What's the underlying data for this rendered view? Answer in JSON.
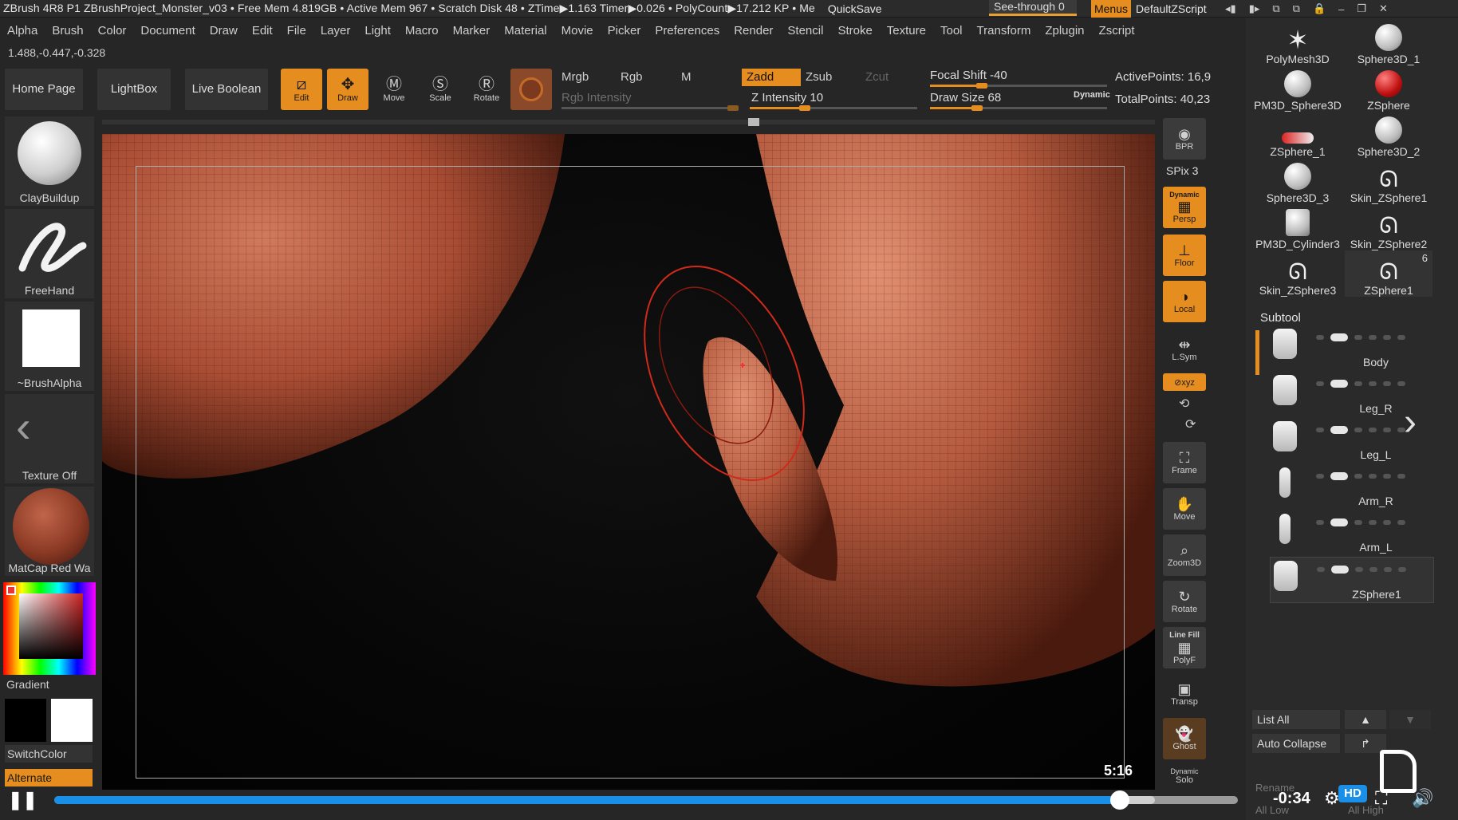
{
  "titlebar": {
    "title": "ZBrush 4R8 P1   ZBrushProject_Monster_v03   • Free Mem 4.819GB • Active Mem 967 • Scratch Disk 48 • ZTime▶1.163 Timer▶0.026 • PolyCount▶17.212 KP • Me",
    "quicksave": "QuickSave",
    "seethrough": "See-through  0",
    "menus": "Menus",
    "default_zscript": "DefaultZScript",
    "icons": [
      "◂▮",
      "▮▸",
      "⧉",
      "⧉",
      "🔒",
      "–",
      "❐",
      "✕"
    ]
  },
  "menubar": [
    "Alpha",
    "Brush",
    "Color",
    "Document",
    "Draw",
    "Edit",
    "File",
    "Layer",
    "Light",
    "Macro",
    "Marker",
    "Material",
    "Movie",
    "Picker",
    "Preferences",
    "Render",
    "Stencil",
    "Stroke",
    "Texture",
    "Tool",
    "Transform",
    "Zplugin",
    "Zscript"
  ],
  "coords": "1.488,-0.447,-0.328",
  "nav": {
    "home": "Home Page",
    "lightbox": "LightBox",
    "live_boolean": "Live Boolean"
  },
  "toolbar": {
    "edit": "Edit",
    "draw": "Draw",
    "move": "Move",
    "scale": "Scale",
    "rotate": "Rotate",
    "mrgb": "Mrgb",
    "rgb": "Rgb",
    "m": "M",
    "zadd": "Zadd",
    "zsub": "Zsub",
    "zcut": "Zcut",
    "rgb_intensity": "Rgb Intensity",
    "z_intensity": "Z Intensity 10",
    "focal_shift": "Focal Shift -40",
    "draw_size": "Draw Size 68",
    "dynamic": "Dynamic",
    "active_points": "ActivePoints: 16,9",
    "total_points": "TotalPoints: 40,23"
  },
  "shelf": {
    "brush": "ClayBuildup",
    "stroke": "FreeHand",
    "alpha": "~BrushAlpha",
    "texture": "Texture Off",
    "material": "MatCap Red Wa",
    "gradient": "Gradient",
    "switch_color": "SwitchColor",
    "alternate": "Alternate"
  },
  "right_toolbar": {
    "bpr": "BPR",
    "spix": "SPix 3",
    "persp": "Persp",
    "persp_tag": "Dynamic",
    "floor": "Floor",
    "local": "Local",
    "lsym": "L.Sym",
    "xyz": "⊘xyz",
    "frame": "Frame",
    "move": "Move",
    "zoom3d": "Zoom3D",
    "rotate": "Rotate",
    "linefill": "Line Fill",
    "polyf": "PolyF",
    "transp": "Transp",
    "ghost": "Ghost",
    "solo_tag": "Dynamic",
    "solo": "Solo"
  },
  "tools": [
    {
      "name": "PolyMesh3D",
      "icon": "star-icon"
    },
    {
      "name": "Sphere3D_1",
      "icon": "sphere-icon"
    },
    {
      "name": "PM3D_Sphere3D",
      "icon": "sphere-icon"
    },
    {
      "name": "ZSphere",
      "icon": "zsphere-icon"
    },
    {
      "name": "ZSphere_1",
      "icon": "zsphere-icon"
    },
    {
      "name": "Sphere3D_2",
      "icon": "sphere-icon"
    },
    {
      "name": "Sphere3D_3",
      "icon": "sphere-icon"
    },
    {
      "name": "Skin_ZSphere1",
      "icon": "skin-icon"
    },
    {
      "name": "PM3D_Cylinder3",
      "icon": "cylinder-icon"
    },
    {
      "name": "Skin_ZSphere2",
      "icon": "skin-icon"
    },
    {
      "name": "Skin_ZSphere3",
      "icon": "skin-icon"
    },
    {
      "name": "ZSphere1",
      "icon": "skin-icon",
      "count": "6"
    }
  ],
  "subtool": {
    "header": "Subtool",
    "items": [
      "Body",
      "Leg_R",
      "Leg_L",
      "Arm_R",
      "Arm_L",
      "ZSphere1"
    ],
    "list_all": "List All",
    "auto_collapse": "Auto Collapse",
    "rename": "Rename",
    "all_low": "All Low",
    "all_high": "All High"
  },
  "video": {
    "current_time": "5:16",
    "remaining": "-0:34",
    "hd": "HD",
    "progress": 0.9
  },
  "colors": {
    "accent": "#e58d1f",
    "clay": "#b35a3e",
    "progress": "#1a8fe8"
  }
}
